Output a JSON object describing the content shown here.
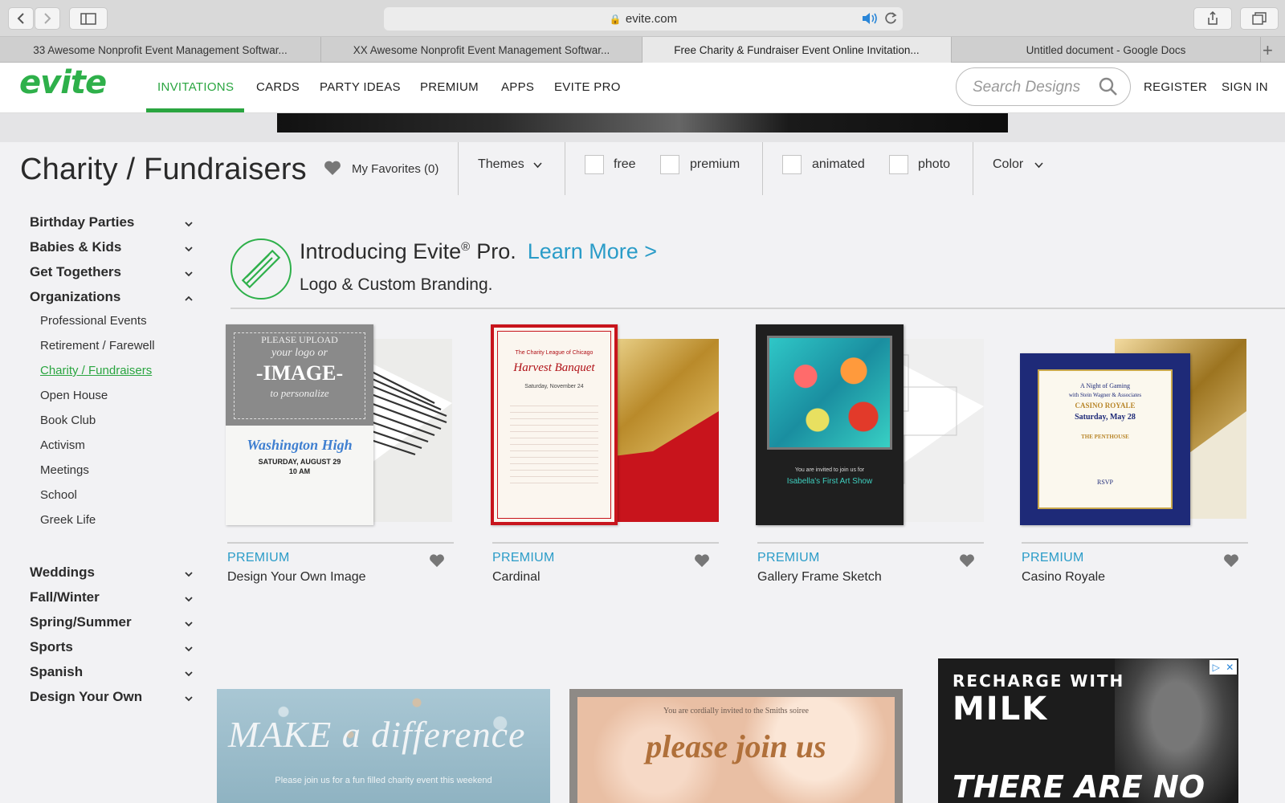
{
  "browser": {
    "address": "evite.com",
    "tabs": [
      "33 Awesome Nonprofit Event Management Softwar...",
      "XX Awesome Nonprofit Event Management Softwar...",
      "Free Charity & Fundraiser Event Online Invitation...",
      "Untitled document - Google Docs"
    ],
    "active_tab": 2
  },
  "header": {
    "logo": "evite",
    "nav": [
      "INVITATIONS",
      "CARDS",
      "PARTY IDEAS",
      "PREMIUM",
      "APPS",
      "EVITE PRO"
    ],
    "active_nav": "INVITATIONS",
    "search_placeholder": "Search Designs",
    "register": "REGISTER",
    "sign_in": "SIGN IN",
    "accent_color": "#2aa540"
  },
  "filters": {
    "title": "Charity / Fundraisers",
    "favorites": "My Favorites (0)",
    "themes": "Themes",
    "free": "free",
    "premium": "premium",
    "animated": "animated",
    "photo": "photo",
    "color": "Color"
  },
  "sidebar": {
    "categories_top": [
      "Birthday Parties",
      "Babies & Kids",
      "Get Togethers",
      "Organizations"
    ],
    "subitems": [
      "Professional Events",
      "Retirement / Farewell",
      "Charity / Fundraisers",
      "Open House",
      "Book Club",
      "Activism",
      "Meetings",
      "School",
      "Greek Life"
    ],
    "active_subitem": "Charity / Fundraisers",
    "categories_bottom": [
      "Weddings",
      "Fall/Winter",
      "Spring/Summer",
      "Sports",
      "Spanish",
      "Design Your Own"
    ]
  },
  "promo": {
    "line1": "Introducing Evite",
    "reg": "®",
    "pro": "Pro.",
    "link": "Learn More >",
    "line2": "Logo & Custom Branding."
  },
  "cards": [
    {
      "tier": "PREMIUM",
      "name": "Design Your Own Image",
      "art": {
        "please": "PLEASE UPLOAD",
        "your": "your logo or",
        "image": "-IMAGE-",
        "pers": "to personalize",
        "school": "Washington High",
        "date": "SATURDAY, AUGUST 29",
        "time": "10 AM"
      }
    },
    {
      "tier": "PREMIUM",
      "name": "Cardinal",
      "art": {
        "org": "The Charity League of Chicago",
        "event": "Harvest Banquet",
        "date": "Saturday, November 24"
      }
    },
    {
      "tier": "PREMIUM",
      "name": "Gallery Frame Sketch",
      "art": {
        "invite": "You are invited to join us for",
        "event": "Isabella's First Art Show"
      }
    },
    {
      "tier": "PREMIUM",
      "name": "Casino Royale",
      "art": {
        "l1": "A Night of Gaming",
        "l2": "with Stein Wagner & Associates",
        "l3": "CASINO ROYALE",
        "l4": "Saturday, May 28",
        "l5": "THE PENTHOUSE",
        "l6": "RSVP"
      }
    }
  ],
  "bottom_cards": [
    {
      "text1": "MAKE a difference",
      "text2": "Please join us for a fun filled charity event this weekend"
    },
    {
      "text1": "You are cordially invited to the Smiths soiree",
      "text2": "please join us"
    }
  ],
  "ad": {
    "l1": "RECHARGE WITH",
    "l2": "MILK",
    "l3": "THERE ARE NO"
  }
}
